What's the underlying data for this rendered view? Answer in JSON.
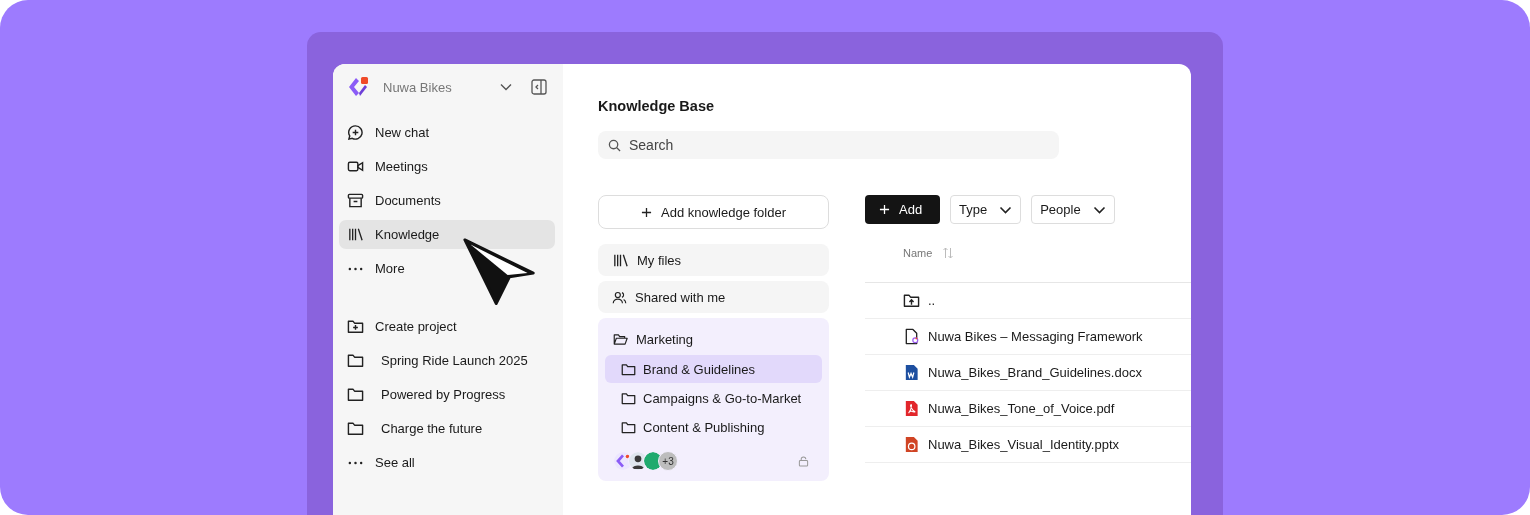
{
  "workspace": {
    "name": "Nuwa Bikes"
  },
  "nav": [
    {
      "label": "New chat",
      "selected": false
    },
    {
      "label": "Meetings",
      "selected": false
    },
    {
      "label": "Documents",
      "selected": false
    },
    {
      "label": "Knowledge",
      "selected": true
    },
    {
      "label": "More",
      "selected": false
    }
  ],
  "create_project": "Create project",
  "projects": [
    "Spring Ride Launch 2025",
    "Powered by Progress",
    "Charge the future"
  ],
  "see_all": "See all",
  "page_title": "Knowledge Base",
  "search": {
    "placeholder": "Search"
  },
  "add_folder_button": "Add knowledge folder",
  "sources": [
    "My files",
    "Shared with me"
  ],
  "folder": {
    "name": "Marketing",
    "expanded": true,
    "members_extra": "+3",
    "locked": true,
    "children": [
      {
        "label": "Brand & Guidelines",
        "selected": true
      },
      {
        "label": "Campaigns & Go-to-Market",
        "selected": false
      },
      {
        "label": "Content & Publishing",
        "selected": false
      }
    ]
  },
  "toolbar": {
    "add": "Add",
    "filters": [
      "Type",
      "People"
    ]
  },
  "table": {
    "columns": [
      {
        "label": "Name",
        "sortable": true
      }
    ],
    "rows": [
      {
        "name": "..",
        "kind": "parent"
      },
      {
        "name": "Nuwa Bikes – Messaging Framework",
        "kind": "doc"
      },
      {
        "name": "Nuwa_Bikes_Brand_Guidelines.docx",
        "kind": "word"
      },
      {
        "name": "Nuwa_Bikes_Tone_of_Voice.pdf",
        "kind": "pdf"
      },
      {
        "name": "Nuwa_Bikes_Visual_Identity.pptx",
        "kind": "ppt"
      }
    ]
  }
}
